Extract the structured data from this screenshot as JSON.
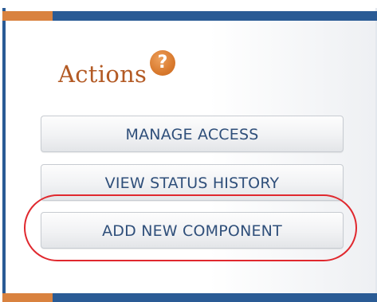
{
  "panel": {
    "title": "Actions",
    "help_icon": "question-icon",
    "help_glyph": "?"
  },
  "actions": {
    "manage_access": "MANAGE ACCESS",
    "view_status_history": "VIEW STATUS HISTORY",
    "add_new_component": "ADD NEW COMPONENT"
  },
  "colors": {
    "accent_orange": "#d9823f",
    "accent_blue": "#2a5b95",
    "title_color": "#b35a24",
    "button_text": "#2f4f7a",
    "highlight_ring": "#e0282e"
  }
}
